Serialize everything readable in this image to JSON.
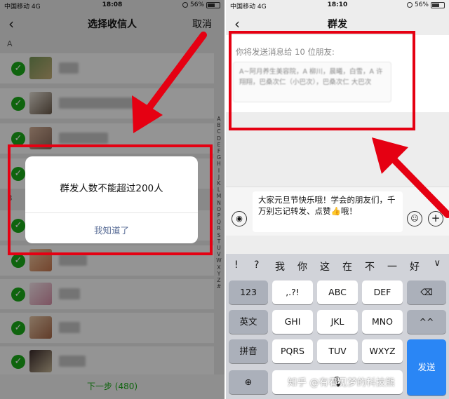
{
  "left": {
    "status": {
      "carrier": "中国移动  4G",
      "time": "18:08",
      "battery": "56%",
      "battery_level": 0.56
    },
    "nav": {
      "back_icon": "chevron-left-icon",
      "title": "选择收信人",
      "cancel": "取消"
    },
    "section_a": "A",
    "section_b": "B",
    "az_index": [
      "A",
      "B",
      "C",
      "D",
      "E",
      "F",
      "G",
      "H",
      "I",
      "J",
      "K",
      "L",
      "M",
      "N",
      "O",
      "P",
      "Q",
      "R",
      "S",
      "T",
      "U",
      "V",
      "W",
      "X",
      "Y",
      "Z",
      "#"
    ],
    "dialog": {
      "message": "群发人数不能超过200人",
      "ok": "我知道了"
    },
    "footer": "下一步 (480)"
  },
  "right": {
    "status": {
      "carrier": "中国移动  4G",
      "time": "18:10",
      "battery": "56%",
      "battery_level": 0.56
    },
    "nav": {
      "back_icon": "chevron-left-icon",
      "title": "群发"
    },
    "send_label": "你将发送消息给 10 位朋友:",
    "recipients": "A~阿月养生美容院，A 柳川，晨曦，白雪，A 许翔翔，巴桑次仁（小巴次），巴桑次仁 大巴次",
    "message": "大家元旦节快乐哦！学会的朋友们，千万别忘记转发、点赞👍哦！",
    "candidates": [
      "!",
      "?",
      "我",
      "你",
      "这",
      "在",
      "不",
      "一",
      "好"
    ],
    "keys": {
      "row1": [
        "123",
        ",.?!",
        "ABC",
        "DEF"
      ],
      "row2": [
        "英文",
        "GHI",
        "JKL",
        "MNO",
        "^^"
      ],
      "row3": [
        "拼音",
        "PQRS",
        "TUV",
        "WXYZ"
      ],
      "send": "发送"
    },
    "watermark": "知乎 @有看见梦的科技熊"
  },
  "colors": {
    "wechat_green": "#1aad19",
    "highlight_red": "#e50012",
    "link_blue": "#576b95",
    "send_blue": "#2a86f5"
  }
}
